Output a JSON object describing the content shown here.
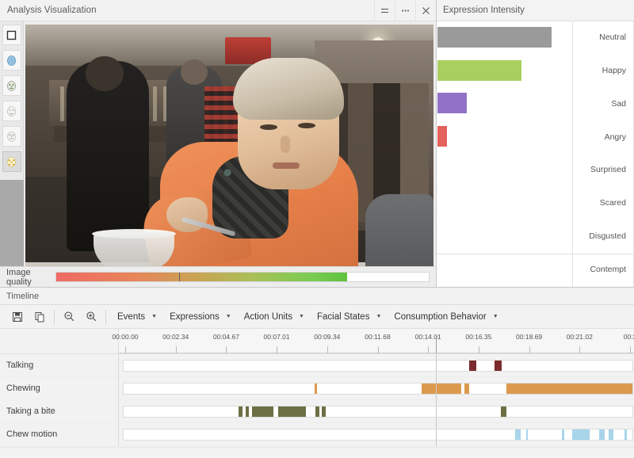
{
  "viz_window": {
    "title": "Analysis Visualization",
    "window_buttons": [
      {
        "name": "menu-icon",
        "glyph": "≡"
      },
      {
        "name": "more-options-icon",
        "glyph": "⋯"
      },
      {
        "name": "close-icon",
        "glyph": "✕"
      }
    ],
    "tools": [
      {
        "name": "frame-tool",
        "label": "Image frame",
        "selected": false
      },
      {
        "name": "face-mesh-tool",
        "label": "Face mesh",
        "selected": false
      },
      {
        "name": "face-landmarks-tool",
        "label": "Face landmarks",
        "selected": false
      },
      {
        "name": "face-outline-tool",
        "label": "Face outline",
        "selected": false
      },
      {
        "name": "face-points-tool",
        "label": "Face points",
        "selected": false
      },
      {
        "name": "action-units-tool",
        "label": "Action units overlay",
        "selected": true
      }
    ],
    "quality": {
      "label": "Image quality",
      "fill_percent": 78,
      "marker_percent": 33
    }
  },
  "expression_panel": {
    "title": "Expression Intensity"
  },
  "chart_data": {
    "type": "bar",
    "title": "Expression Intensity",
    "orientation": "horizontal",
    "categories": [
      "Neutral",
      "Happy",
      "Sad",
      "Angry",
      "Surprised",
      "Scared",
      "Disgusted",
      "Contempt"
    ],
    "values": [
      86,
      63,
      22,
      7,
      0,
      0,
      0,
      0
    ],
    "colors": [
      "#9a9a9a",
      "#a8cf5f",
      "#9172c6",
      "#e4615c",
      "#5bb8d6",
      "#d9c24a",
      "#7fbf6a",
      "#c97fb0"
    ],
    "xlabel": "",
    "ylabel": "",
    "xlim": [
      0,
      100
    ],
    "grid": false,
    "legend": false,
    "separator_before": "Contempt"
  },
  "timeline": {
    "title": "Timeline",
    "toolbar": {
      "icons": [
        {
          "name": "save-icon",
          "label": "Save"
        },
        {
          "name": "copy-icon",
          "label": "Copy"
        },
        {
          "name": "zoom-out-icon",
          "label": "Zoom out"
        },
        {
          "name": "zoom-in-icon",
          "label": "Zoom in"
        }
      ],
      "menus": [
        {
          "name": "events-menu",
          "label": "Events"
        },
        {
          "name": "expressions-menu",
          "label": "Expressions"
        },
        {
          "name": "action-units-menu",
          "label": "Action Units"
        },
        {
          "name": "facial-states-menu",
          "label": "Facial States"
        },
        {
          "name": "consumption-behavior-menu",
          "label": "Consumption Behavior"
        }
      ],
      "caret": "▼"
    },
    "ruler": {
      "ticks": [
        {
          "label": "00:00.00",
          "pos": 0.0
        },
        {
          "label": "00:02.34",
          "pos": 0.1
        },
        {
          "label": "00:04.67",
          "pos": 0.2
        },
        {
          "label": "00:07.01",
          "pos": 0.3
        },
        {
          "label": "00:09.34",
          "pos": 0.4
        },
        {
          "label": "00:11.68",
          "pos": 0.5
        },
        {
          "label": "00:14.01",
          "pos": 0.6
        },
        {
          "label": "00:16.35",
          "pos": 0.7
        },
        {
          "label": "00:18.69",
          "pos": 0.8
        },
        {
          "label": "00:21.02",
          "pos": 0.9
        },
        {
          "label": "00:2",
          "pos": 1.0
        }
      ],
      "playhead_pos": 0.616
    },
    "tracks": [
      {
        "name": "Talking",
        "color": "#7b2b2b",
        "segments": [
          {
            "start": 0.679,
            "end": 0.693
          },
          {
            "start": 0.729,
            "end": 0.743
          }
        ]
      },
      {
        "name": "Chewing",
        "color": "#dc9a4e",
        "segments": [
          {
            "start": 0.375,
            "end": 0.38
          },
          {
            "start": 0.585,
            "end": 0.663
          },
          {
            "start": 0.67,
            "end": 0.679
          },
          {
            "start": 0.752,
            "end": 1.0
          }
        ]
      },
      {
        "name": "Taking a bite",
        "color": "#6c7044",
        "segments": [
          {
            "start": 0.226,
            "end": 0.234
          },
          {
            "start": 0.24,
            "end": 0.246
          },
          {
            "start": 0.252,
            "end": 0.295
          },
          {
            "start": 0.304,
            "end": 0.358
          },
          {
            "start": 0.377,
            "end": 0.385
          },
          {
            "start": 0.389,
            "end": 0.397
          },
          {
            "start": 0.741,
            "end": 0.753
          }
        ]
      },
      {
        "name": "Chew motion",
        "color": "#a8d5ea",
        "segments": [
          {
            "start": 0.77,
            "end": 0.78
          },
          {
            "start": 0.791,
            "end": 0.795
          },
          {
            "start": 0.862,
            "end": 0.866
          },
          {
            "start": 0.882,
            "end": 0.916
          },
          {
            "start": 0.934,
            "end": 0.945
          },
          {
            "start": 0.954,
            "end": 0.962
          },
          {
            "start": 0.985,
            "end": 0.989
          }
        ]
      }
    ]
  }
}
